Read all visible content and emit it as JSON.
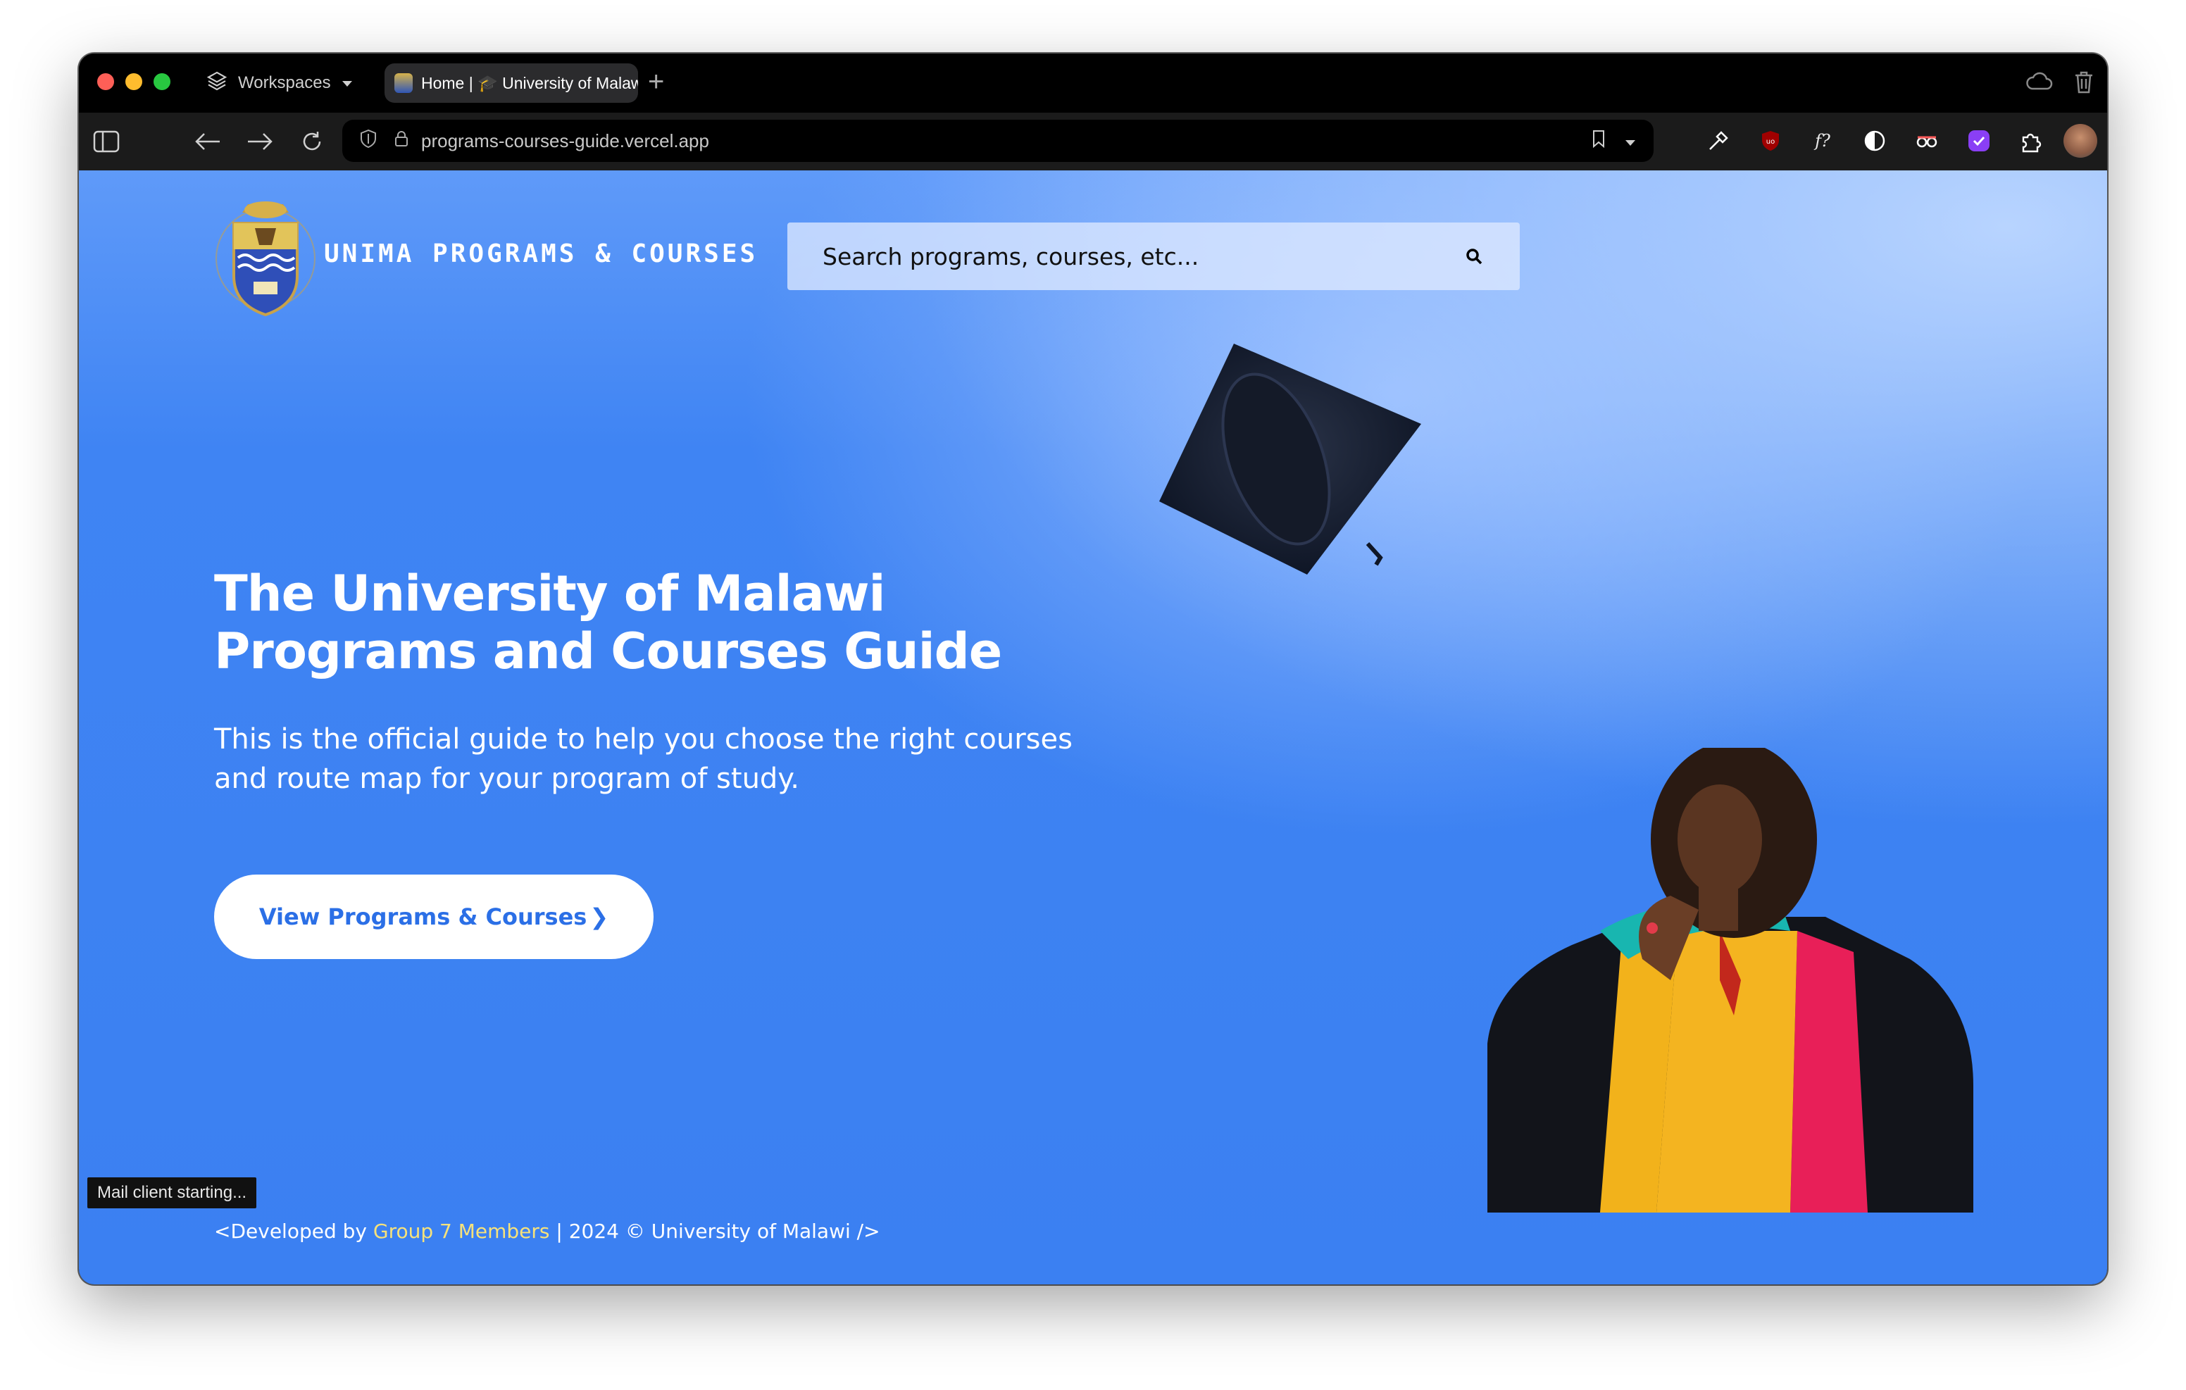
{
  "browser": {
    "workspaces_label": "Workspaces",
    "tab_title": "Home | 🎓 University of Malawi",
    "url": "programs-courses-guide.vercel.app",
    "status_text": "Mail client starting..."
  },
  "site": {
    "brand": "UNIMA PROGRAMS & COURSES",
    "search_placeholder": "Search programs, courses, etc...",
    "hero_title_line1": "The University of Malawi",
    "hero_title_line2": "Programs and Courses Guide",
    "hero_subtitle": "This is the official guide to help you choose the right courses and route map for your program of study.",
    "cta_label": "View Programs & Courses",
    "cta_chevron": "❯",
    "footer": {
      "prefix": "<Developed by ",
      "link": "Group 7 Members",
      "suffix": " | 2024 © University of Malawi />"
    }
  },
  "colors": {
    "accent": "#3b80f2",
    "cta_text": "#2b6fe6",
    "footer_link": "#f7e27a"
  },
  "icons": [
    "sidebar-toggle-icon",
    "back-icon",
    "forward-icon",
    "reload-icon",
    "shield-icon",
    "lock-icon",
    "bookmark-icon",
    "search-icon",
    "cloud-icon",
    "trash-icon",
    "layers-icon"
  ]
}
